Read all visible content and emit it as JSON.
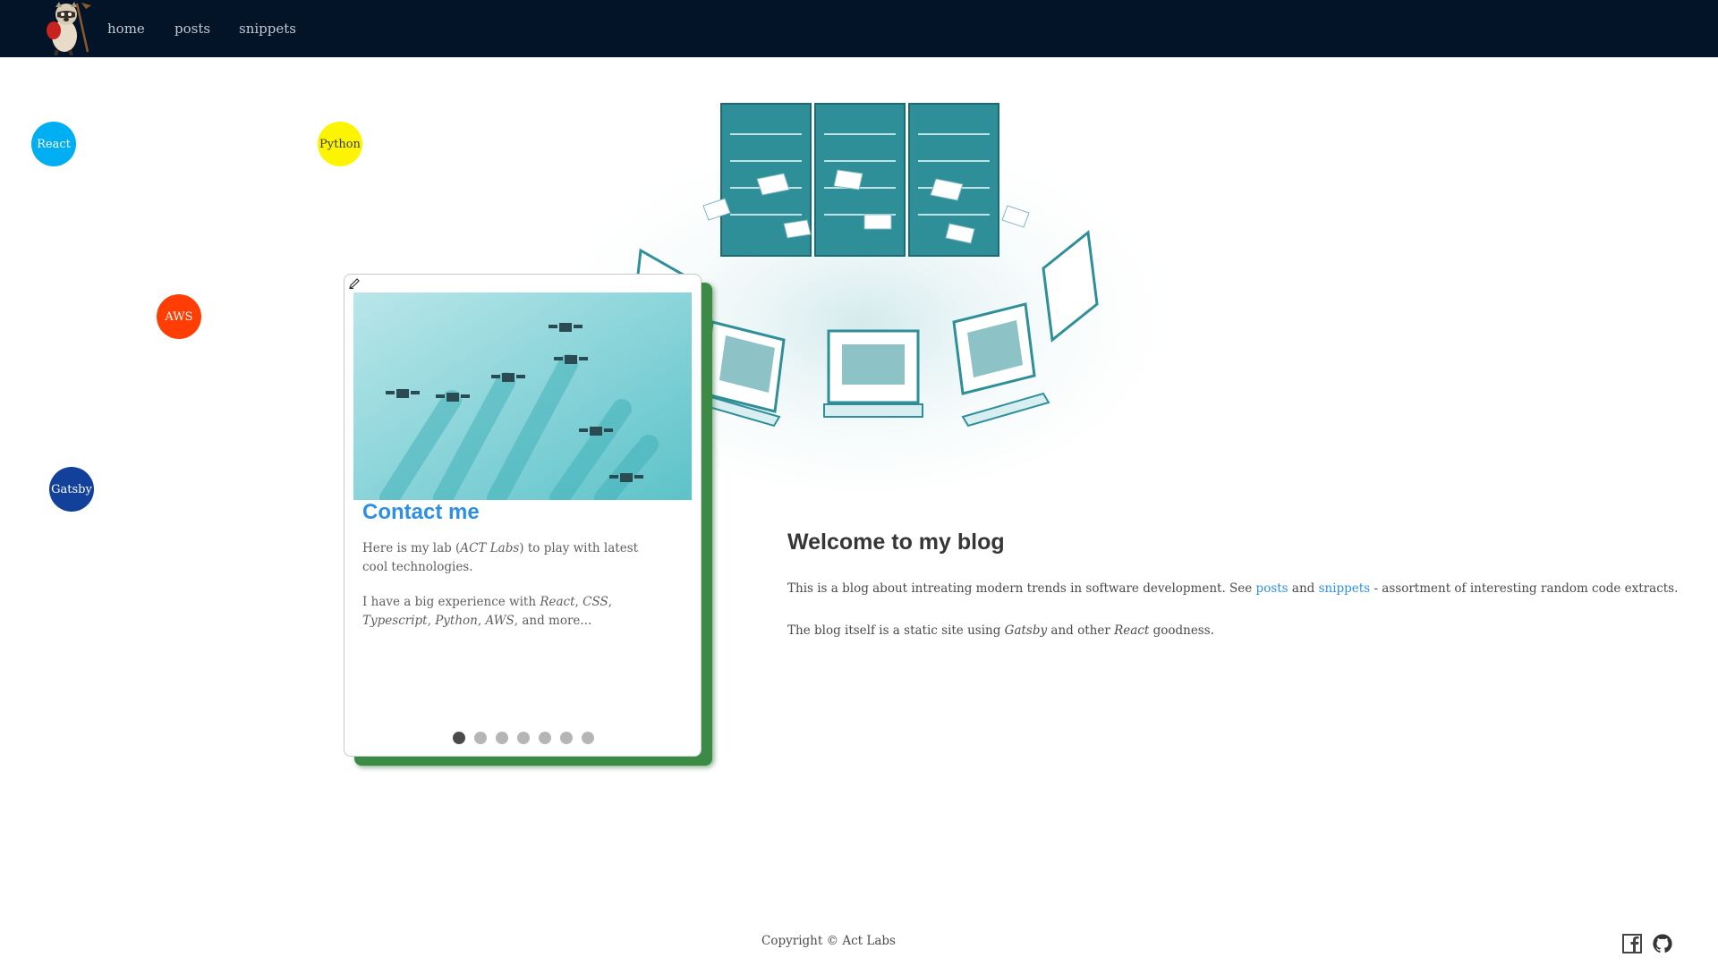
{
  "nav": {
    "links": [
      "home",
      "posts",
      "snippets"
    ]
  },
  "bubbles": {
    "react": "React",
    "python": "Python",
    "aws": "AWS",
    "gatsby": "Gatsby"
  },
  "card": {
    "title": "Contact me",
    "p1": {
      "before": "Here is my lab (",
      "em": "ACT Labs",
      "after": ") to play with latest cool technologies."
    },
    "p2": {
      "before": "I have a big experience with ",
      "em1": "React",
      "sep1": ", ",
      "em2": "CSS",
      "sep2": ", ",
      "em3": "Typescript",
      "sep3": ", ",
      "em4": "Python",
      "sep4": ", ",
      "em5": "AWS",
      "after": ", and more..."
    },
    "slides_total": 7,
    "active_slide": 1
  },
  "welcome": {
    "title": "Welcome to my blog",
    "p1": {
      "before": "This is a blog about intreating modern trends in software development. See ",
      "link1": "posts",
      "mid": " and ",
      "link2": "snippets",
      "after": " - assortment of interesting random code extracts."
    },
    "p2": {
      "before": "The blog itself is a static site using ",
      "em1": "Gatsby",
      "mid": " and other ",
      "em2": "React",
      "after": " goodness."
    }
  },
  "footer": {
    "copyright": "Copyright © Act Labs"
  },
  "icons": {
    "logo": "raccoon-mascot-logo",
    "edit": "pencil-icon",
    "facebook": "facebook-icon",
    "github": "github-icon"
  },
  "colors": {
    "navbar": "#031428",
    "link": "#2f8fe3",
    "card_shadow": "#3c8a46",
    "react": "#00aef2",
    "python": "#fdf400",
    "aws": "#fe3e04",
    "gatsby": "#12409b"
  }
}
